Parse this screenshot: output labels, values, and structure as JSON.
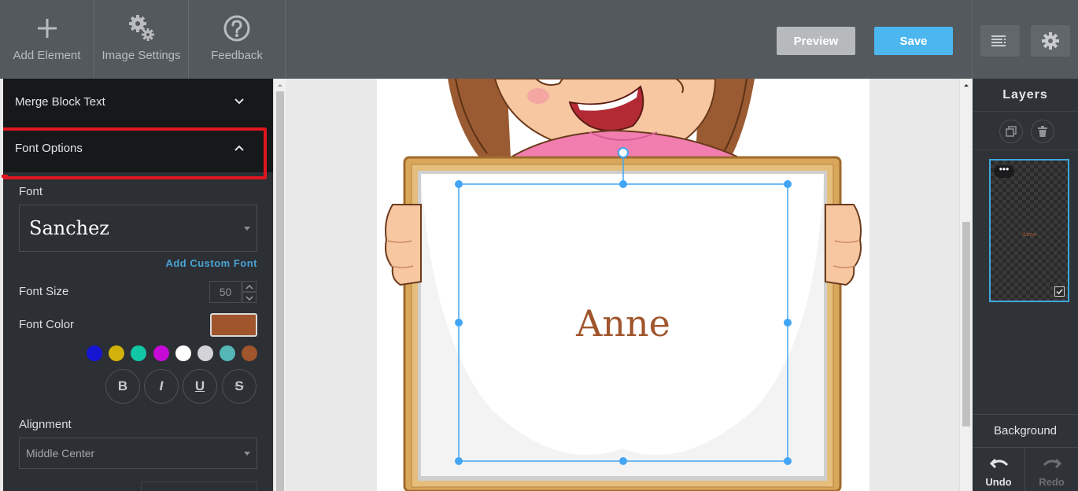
{
  "toolbar": {
    "add_element": "Add Element",
    "image_settings": "Image Settings",
    "feedback": "Feedback",
    "preview": "Preview",
    "save": "Save"
  },
  "left_panel": {
    "merge_block_text": "Merge Block Text",
    "font_options": "Font Options",
    "font_label": "Font",
    "font_value": "Sanchez",
    "add_custom_font": "Add Custom Font",
    "font_size_label": "Font Size",
    "font_size_value": "50",
    "font_color_label": "Font Color",
    "font_color_value": "#a0552c",
    "color_swatches": [
      "#1414d2",
      "#d2b10a",
      "#12c7a6",
      "#c50ad6",
      "#ffffff",
      "#d3d3d8",
      "#55b6b6",
      "#a0552c"
    ],
    "style_buttons": [
      "B",
      "I",
      "U",
      "S"
    ],
    "alignment_label": "Alignment",
    "alignment_value": "Middle Center"
  },
  "canvas": {
    "text_layer": "Anne",
    "text_color": "#a0552c",
    "selection_color": "#42a5f5"
  },
  "layers_panel": {
    "title": "Layers",
    "layer_menu": "•••",
    "layer_thumb_text": "Anne",
    "background": "Background",
    "undo": "Undo",
    "redo": "Redo"
  },
  "colors": {
    "toolbar_bg": "#54595d",
    "panel_bg": "#2c2f33",
    "accent_blue": "#4cb7ee",
    "highlight_red": "#e0161f"
  }
}
